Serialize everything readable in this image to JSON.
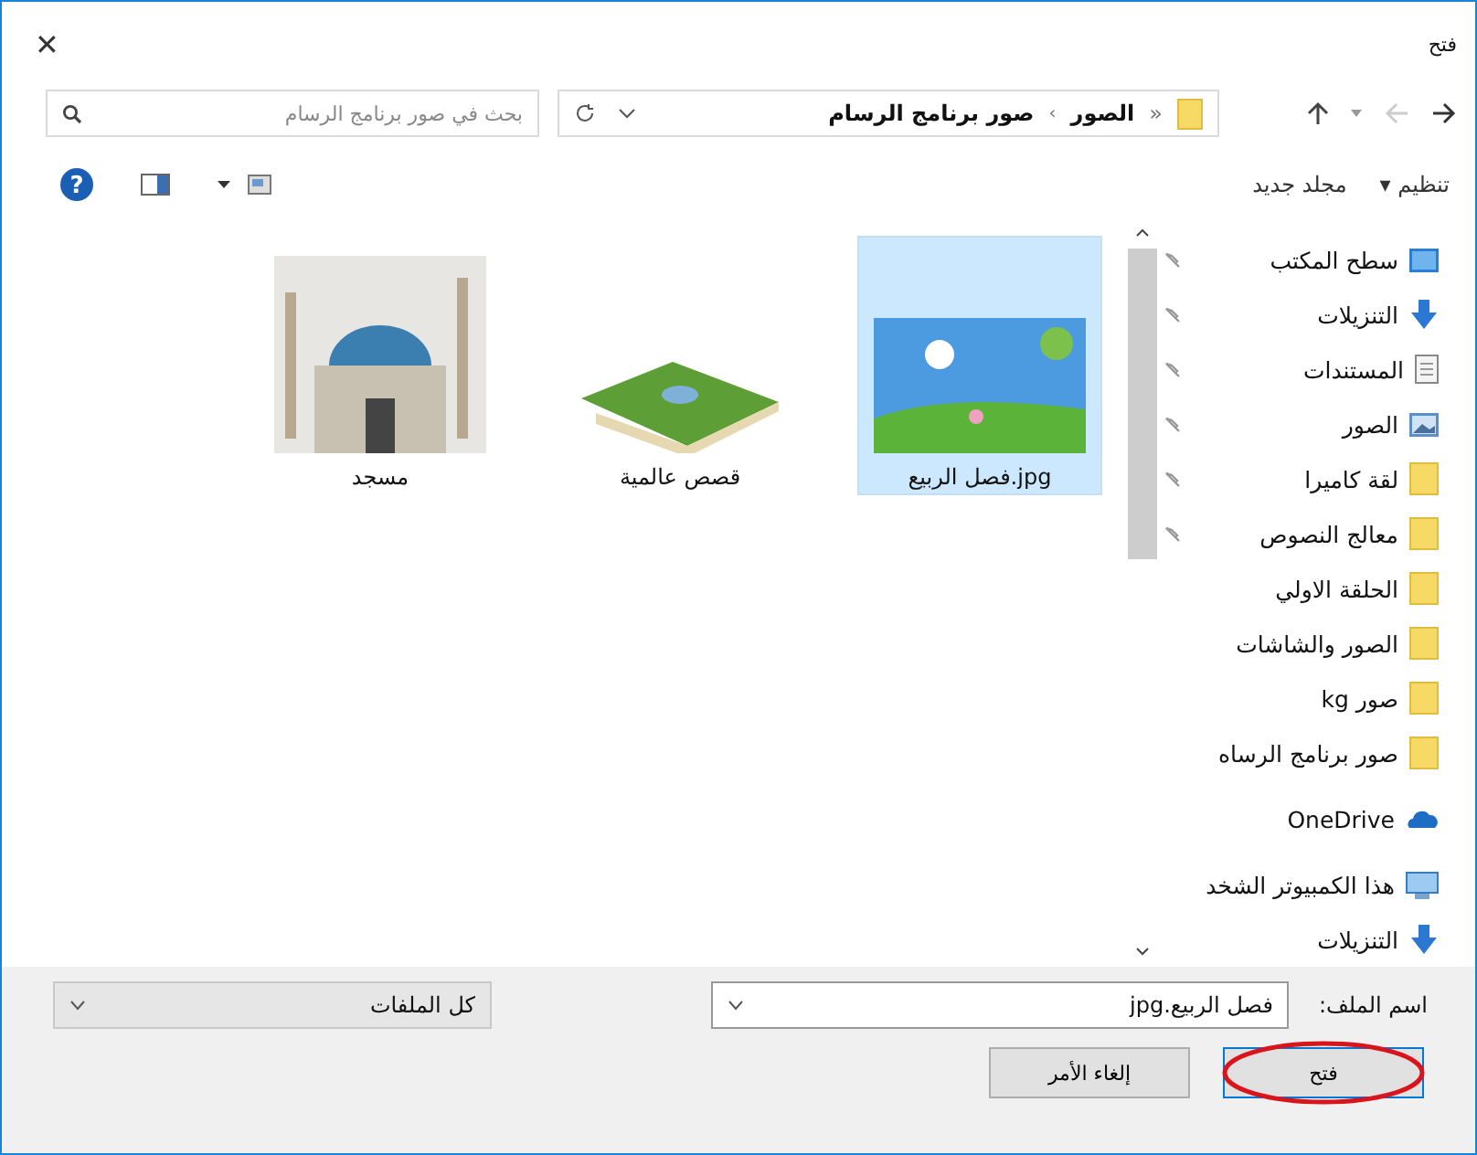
{
  "window": {
    "title": "فتح",
    "close": "✕"
  },
  "address": {
    "overflow": "«",
    "crumbs": [
      {
        "label": "الصور"
      },
      {
        "label": "صور برنامج الرسام"
      }
    ],
    "separator": "›"
  },
  "search": {
    "placeholder": "بحث في صور برنامج الرسام"
  },
  "toolbar": {
    "organize": "تنظيم",
    "organize_caret": "▾",
    "new_folder": "مجلد جديد",
    "help": "?"
  },
  "nav_items": [
    {
      "label": "سطح المكتب",
      "kind": "desktop",
      "pinned": true
    },
    {
      "label": "التنزيلات",
      "kind": "download",
      "pinned": true
    },
    {
      "label": "المستندات",
      "kind": "document",
      "pinned": true
    },
    {
      "label": "الصور",
      "kind": "pictures",
      "pinned": true
    },
    {
      "label": "لقة كاميرا",
      "kind": "folder",
      "pinned": true
    },
    {
      "label": "معالج النصوص",
      "kind": "folder",
      "pinned": true
    },
    {
      "label": "الحلقة الاولي",
      "kind": "folder",
      "pinned": false
    },
    {
      "label": "الصور والشاشات",
      "kind": "folder",
      "pinned": false
    },
    {
      "label": "صور kg",
      "kind": "folder",
      "pinned": false
    },
    {
      "label": "صور برنامج الرساه",
      "kind": "folder",
      "pinned": false
    },
    {
      "label": "OneDrive",
      "kind": "cloud",
      "pinned": false
    },
    {
      "label": "هذا الكمبيوتر الشخد",
      "kind": "computer",
      "pinned": false
    },
    {
      "label": "التنزيلات",
      "kind": "download",
      "pinned": false
    }
  ],
  "files": [
    {
      "name": "jpg.فصل الربيع",
      "kind": "landscape",
      "selected": true
    },
    {
      "name": "قصص عالمية",
      "kind": "book",
      "selected": false
    },
    {
      "name": "مسجد",
      "kind": "mosque",
      "selected": false
    }
  ],
  "file_name": {
    "label": "اسم الملف:",
    "value": "فصل الربيع.jpg"
  },
  "file_type": {
    "value": "كل الملفات"
  },
  "buttons": [
    {
      "label": "فتح",
      "kind": "primary",
      "circled": true
    },
    {
      "label": "إلغاء الأمر",
      "kind": "normal",
      "circled": false
    }
  ]
}
